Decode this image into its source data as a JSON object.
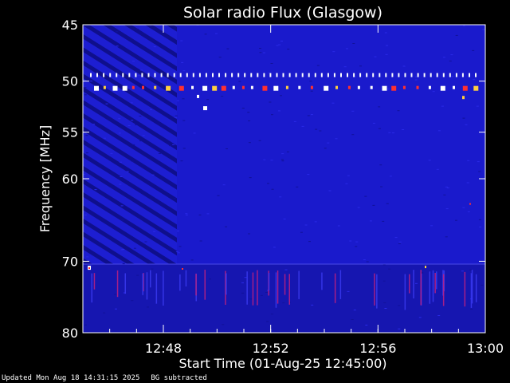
{
  "chart_data": {
    "type": "heatmap",
    "title": "Solar radio Flux (Glasgow)",
    "ylabel": "Frequency [MHz]",
    "xlabel": "Start Time (01-Aug-25 12:45:00)",
    "y_ticks": [
      45,
      50,
      55,
      60,
      70,
      80
    ],
    "ylim": [
      45,
      80
    ],
    "y_scale": "log",
    "x_ticks": [
      "12:48",
      "12:52",
      "12:56",
      "13:00"
    ],
    "x_tick_minutes": [
      3,
      7,
      11,
      15
    ],
    "xlim_minutes": [
      0,
      15
    ],
    "colors": {
      "background": "#1a1acc",
      "band": "#ffffff",
      "burst": "#ff2020"
    }
  },
  "footer": {
    "updated": "Updated Mon Aug 18 14:31:15 2025",
    "note": "BG subtracted"
  }
}
